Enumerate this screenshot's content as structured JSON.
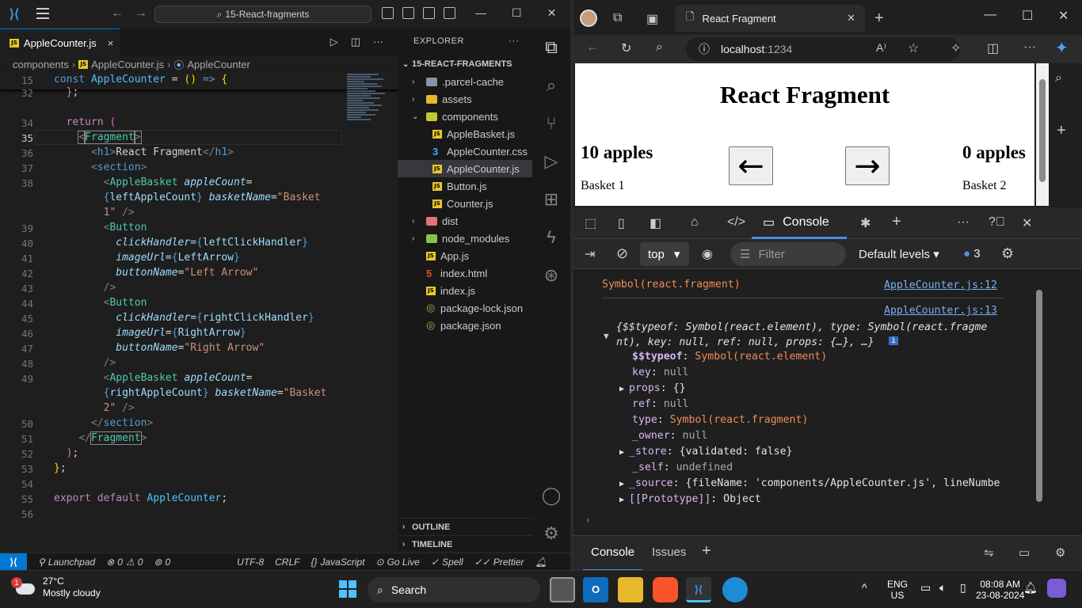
{
  "vscode": {
    "command_center": "15-React-fragments",
    "tab": {
      "label": "AppleCounter.js",
      "close": "×"
    },
    "breadcrumbs": [
      "components",
      "AppleCounter.js",
      "AppleCounter"
    ],
    "sticky": {
      "line": "15",
      "code": "const AppleCounter = () => {"
    },
    "explorer": {
      "title": "EXPLORER",
      "root": "15-REACT-FRAGMENTS",
      "items": [
        {
          "label": ".parcel-cache",
          "type": "folder"
        },
        {
          "label": "assets",
          "type": "folder"
        },
        {
          "label": "components",
          "type": "folder-open"
        },
        {
          "label": "AppleBasket.js",
          "type": "js"
        },
        {
          "label": "AppleCounter.css",
          "type": "css"
        },
        {
          "label": "AppleCounter.js",
          "type": "js"
        },
        {
          "label": "Button.js",
          "type": "js"
        },
        {
          "label": "Counter.js",
          "type": "js"
        },
        {
          "label": "dist",
          "type": "folder"
        },
        {
          "label": "node_modules",
          "type": "folder"
        },
        {
          "label": "App.js",
          "type": "js"
        },
        {
          "label": "index.html",
          "type": "html"
        },
        {
          "label": "index.js",
          "type": "js"
        },
        {
          "label": "package-lock.json",
          "type": "json"
        },
        {
          "label": "package.json",
          "type": "json"
        }
      ],
      "outline": "OUTLINE",
      "timeline": "TIMELINE"
    },
    "status": {
      "launchpad": "Launchpad",
      "problems": "0",
      "warnings": "0",
      "ports": "0",
      "encoding": "UTF-8",
      "eol": "CRLF",
      "language": "JavaScript",
      "golive": "Go Live",
      "spell": "Spell",
      "prettier": "Prettier"
    }
  },
  "edge": {
    "tab_title": "React Fragment",
    "address_host": "localhost",
    "address_port": ":1234",
    "page": {
      "heading": "React Fragment",
      "left_count": "10 apples",
      "left_name": "Basket 1",
      "right_count": "0 apples",
      "right_name": "Basket 2"
    },
    "devtools": {
      "console_tab": "Console",
      "context": "top",
      "filter_placeholder": "Filter",
      "levels": "Default levels",
      "message_count": "3",
      "log1": "Symbol(react.fragment)",
      "log1_src": "AppleCounter.js:12",
      "log2_src": "AppleCounter.js:13",
      "obj_line1": "{$$typeof: Symbol(react.element), type: Symbol(react.fragme",
      "obj_line2": "nt), key: null, ref: null, props: {…}, …}",
      "props": [
        {
          "key": "$$typeof",
          "value": "Symbol(react.element)"
        },
        {
          "key": "key",
          "value": "null"
        },
        {
          "key": "props",
          "value": "{}"
        },
        {
          "key": "ref",
          "value": "null"
        },
        {
          "key": "type",
          "value": "Symbol(react.fragment)"
        },
        {
          "key": "_owner",
          "value": "null"
        },
        {
          "key": "_store",
          "value": "{validated: false}"
        },
        {
          "key": "_self",
          "value": "undefined"
        },
        {
          "key": "_source",
          "value": "{fileName: 'components/AppleCounter.js', lineNumbe"
        },
        {
          "key": "[[Prototype]]",
          "value": "Object"
        }
      ],
      "bottom_tabs": [
        "Console",
        "Issues"
      ]
    }
  },
  "taskbar": {
    "weather_temp": "27°C",
    "weather_desc": "Mostly cloudy",
    "weather_badge": "1",
    "search": "Search",
    "lang1": "ENG",
    "lang2": "US",
    "time": "08:08 AM",
    "date": "23-08-2024"
  }
}
